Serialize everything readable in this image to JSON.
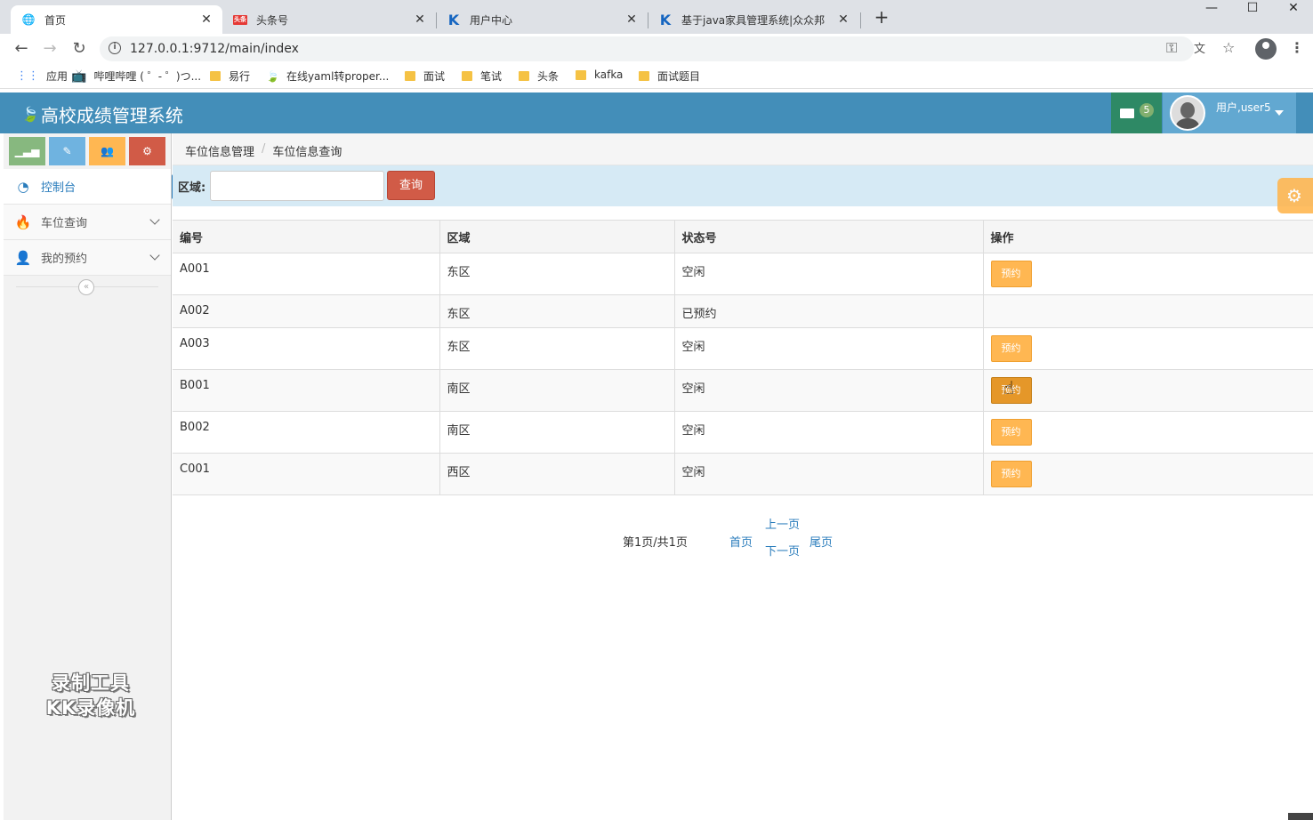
{
  "browser": {
    "tabs": [
      {
        "title": "首页",
        "favicon": "globe-icon",
        "active": true
      },
      {
        "title": "头条号",
        "favicon": "toutiao-icon",
        "active": false
      },
      {
        "title": "用户中心",
        "favicon": "k-icon",
        "active": false
      },
      {
        "title": "基于java家具管理系统|众众邦",
        "favicon": "k-icon",
        "active": false
      }
    ],
    "url": "127.0.0.1:9712/main/index",
    "bookmarks": [
      {
        "label": "应用",
        "icon": "apps-icon"
      },
      {
        "label": "哔哩哔哩 ( ゜- ゜)つ...",
        "icon": "bilibili-icon"
      },
      {
        "label": "易行",
        "icon": "folder-icon"
      },
      {
        "label": "在线yaml转proper...",
        "icon": "leaf-icon"
      },
      {
        "label": "面试",
        "icon": "folder-icon"
      },
      {
        "label": "笔试",
        "icon": "folder-icon"
      },
      {
        "label": "头条",
        "icon": "folder-icon"
      },
      {
        "label": "kafka",
        "icon": "folder-icon"
      },
      {
        "label": "面试题目",
        "icon": "folder-icon"
      }
    ]
  },
  "app": {
    "title": "高校成绩管理系统",
    "mail_count": "5",
    "user_label": "用户,user5",
    "colors": {
      "header": "#438eb9",
      "mail": "#2e8965",
      "user": "#62a8d1",
      "query": "#d15b47",
      "reserve": "#ffb752"
    }
  },
  "sidebar": {
    "items": [
      {
        "label": "控制台",
        "icon": "dashboard-icon",
        "active": true
      },
      {
        "label": "车位查询",
        "icon": "fire-icon",
        "active": false
      },
      {
        "label": "我的预约",
        "icon": "user-icon",
        "active": false
      }
    ],
    "watermark_line1": "录制工具",
    "watermark_line2": "KK录像机"
  },
  "breadcrumb": [
    "车位信息管理",
    "车位信息查询"
  ],
  "search": {
    "label": "区域:",
    "value": "",
    "button": "查询"
  },
  "table": {
    "headers": [
      "编号",
      "区域",
      "状态号",
      "操作"
    ],
    "rows": [
      {
        "id": "A001",
        "area": "东区",
        "status": "空闲",
        "action": "预约"
      },
      {
        "id": "A002",
        "area": "东区",
        "status": "已预约",
        "action": ""
      },
      {
        "id": "A003",
        "area": "东区",
        "status": "空闲",
        "action": "预约"
      },
      {
        "id": "B001",
        "area": "南区",
        "status": "空闲",
        "action": "预约"
      },
      {
        "id": "B002",
        "area": "南区",
        "status": "空闲",
        "action": "预约"
      },
      {
        "id": "C001",
        "area": "西区",
        "status": "空闲",
        "action": "预约"
      }
    ]
  },
  "pager": {
    "info": "第1页/共1页",
    "first": "首页",
    "prev": "上一页",
    "next": "下一页",
    "last": "尾页"
  }
}
